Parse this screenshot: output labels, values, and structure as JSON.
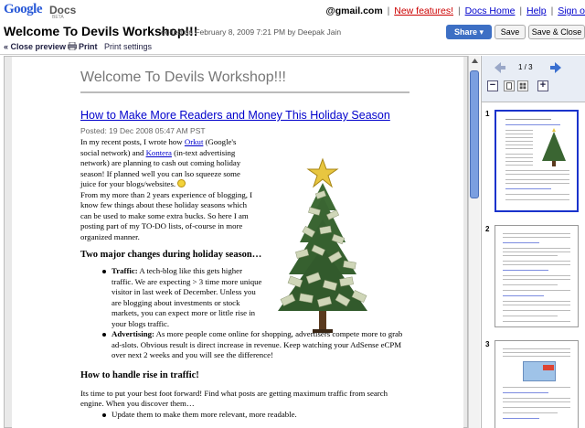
{
  "app": {
    "logo_google": "Google",
    "logo_docs": "Docs",
    "logo_beta": "BETA"
  },
  "userbar": {
    "email": "@gmail.com",
    "new_features": "New features!",
    "docs_home": "Docs Home",
    "help": "Help",
    "sign_out": "Sign o"
  },
  "document": {
    "title": "Welcome To Devils Workshop!!!",
    "edited": "edited on February 8, 2009 7:21 PM by Deepak Jain"
  },
  "buttons": {
    "share": "Share ▾",
    "save": "Save",
    "save_close": "Save & Close"
  },
  "toolbar": {
    "close_preview": "« Close preview",
    "print": "Print",
    "print_settings": "Print settings"
  },
  "page": {
    "heading": "Welcome To Devils Workshop!!!",
    "post_title": "How to Make More Readers and Money This Holiday Season",
    "posted": "Posted: 19 Dec 2008 05:47 AM PST",
    "p1_a": "In my recent posts, I wrote how ",
    "p1_link1": "Orkut",
    "p1_b": " (Google's social network) and ",
    "p1_link2": "Kontera",
    "p1_c": " (in-text advertising network) are planning to cash out coming holiday season! If planned well you can lso squeeze some juice for your blogs/websites.",
    "p2": "From my more than 2 years experience of blogging, I know few things about these holiday seasons which can be used to make some extra bucks. So here I am posting part of my TO-DO lists, of-course in more organized manner.",
    "h2_1": "Two major changes during holiday season…",
    "b1_label": "Traffic:",
    "b1_text": " A tech-blog like this gets higher traffic. We are expecting > 3 time more unique visitor in last week of December. Unless you are blogging about investments or stock markets, you can expect more or little rise in your blogs traffic.",
    "b2_label": "Advertising:",
    "b2_text": " As more people come online for shopping, advertisers compete more to grab ad-slots. Obvious result is direct increase in revenue. Keep watching your AdSense eCPM over next 2 weeks and you will see the difference!",
    "h2_2": "How to handle rise in traffic!",
    "p3": "Its time to put your best foot forward! Find what posts are getting maximum traffic from search engine. When you discover them…",
    "b3_text": "Update them to make them more relevant, more readable."
  },
  "thumbnails": {
    "page_indicator": "1 / 3",
    "items": [
      {
        "num": "1"
      },
      {
        "num": "2"
      },
      {
        "num": "3"
      }
    ]
  },
  "colors": {
    "link": "#0000cc",
    "share_button": "#3d6fc4",
    "selected_thumb": "#1a33cc"
  }
}
